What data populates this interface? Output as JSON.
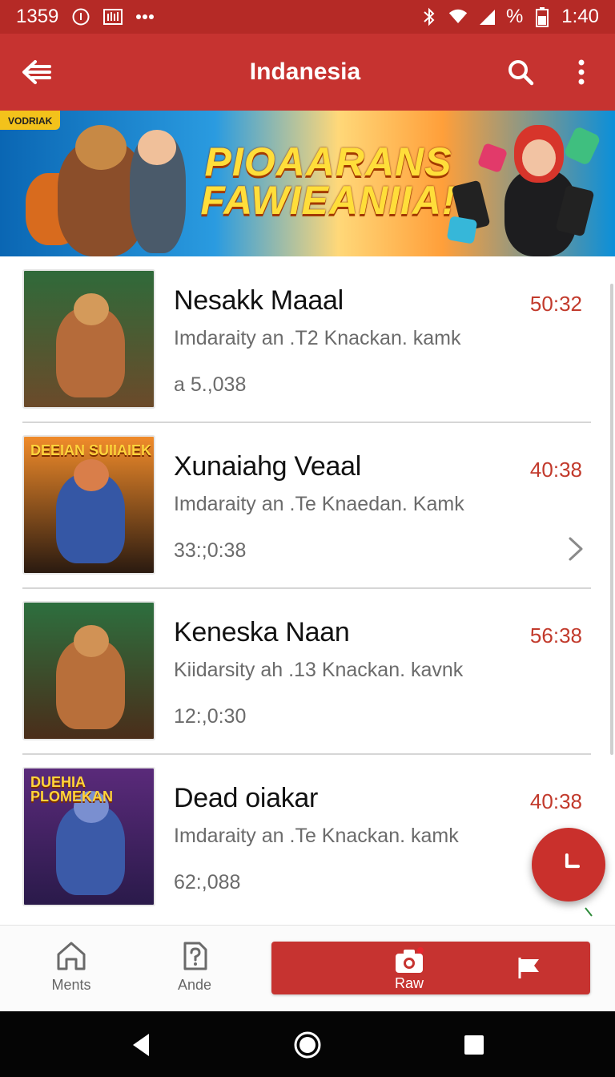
{
  "status_bar": {
    "left_text": "1359",
    "right_percent": "%",
    "time": "1:40"
  },
  "app_bar": {
    "title": "Indanesia",
    "icons": [
      "back-arrow-icon",
      "search-icon",
      "more-vertical-icon"
    ]
  },
  "banner": {
    "tag": "VODRIAK",
    "headline_line1": "PIOAARANS",
    "headline_line2": "FAWIEANIIA!"
  },
  "items": [
    {
      "title": "Nesakk Maaal",
      "subtitle": "Imdaraity an .T2 Knackan. kamk",
      "meta": "a 5.,038",
      "time": "50:32",
      "thumb_top": "",
      "thumb_bottom": "",
      "colors": {
        "bg1": "#2f6a3a",
        "bg2": "#6b4a2a",
        "figure": "#b56b3a",
        "head": "#d49a5a"
      }
    },
    {
      "title": "Xunaiahg Veaal",
      "subtitle": "Imdaraity an .Te Knaedan. Kamk",
      "meta": "33:;0:38",
      "time": "40:38",
      "thumb_top": "DEEIAN SUIIAIEK",
      "thumb_bottom": "",
      "colors": {
        "bg1": "#f08b2a",
        "bg2": "#2a1a10",
        "figure": "#3557a5",
        "head": "#d97e4a"
      }
    },
    {
      "title": "Keneska Naan",
      "subtitle": "Kiidarsity ah .13 Knackan. kavnk",
      "meta": "12:,0:30",
      "time": "56:38",
      "thumb_top": "",
      "thumb_bottom": "",
      "colors": {
        "bg1": "#2d6f3e",
        "bg2": "#4a2d1a",
        "figure": "#b86f3a",
        "head": "#d19255"
      }
    },
    {
      "title": "Dead oiakar",
      "subtitle": "Imdaraity an .Te Knackan. kamk",
      "meta": "62:,088",
      "time": "40:38",
      "thumb_top": "DUEHIA PLOMEKAN",
      "thumb_bottom": "",
      "colors": {
        "bg1": "#5a2a7a",
        "bg2": "#2a1a4a",
        "figure": "#3b5aa8",
        "head": "#7a8fd0"
      }
    }
  ],
  "bottom_nav": {
    "items": [
      {
        "label": "Ments",
        "icon": "home-icon"
      },
      {
        "label": "Ande",
        "icon": "help-document-icon"
      }
    ],
    "active": {
      "label": "Raw",
      "icon": "camera-icon",
      "secondary_icon": "flag-icon"
    }
  },
  "system_nav": [
    "back-triangle-icon",
    "home-circle-icon",
    "recents-square-icon"
  ],
  "colors": {
    "primary": "#c63330",
    "primary_dark": "#b52a26",
    "time_red": "#c23a2c",
    "text_dark": "#111111",
    "text_grey": "#6b6b6b"
  }
}
